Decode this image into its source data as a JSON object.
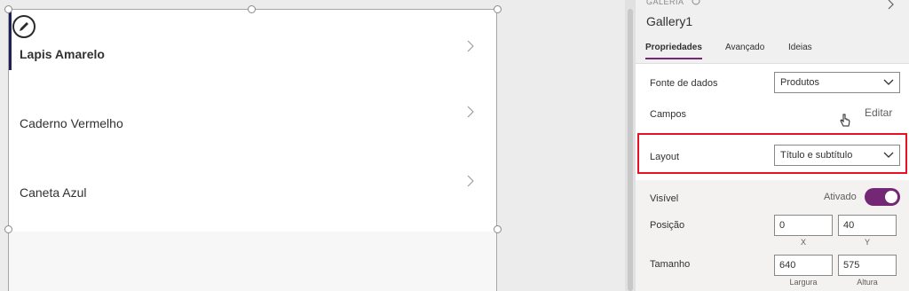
{
  "gallery": {
    "rows": [
      {
        "title": "Lapis Amarelo"
      },
      {
        "title": "Caderno Vermelho"
      },
      {
        "title": "Caneta Azul"
      }
    ]
  },
  "panel": {
    "control_type": "GALERIA",
    "control_name": "Gallery1",
    "tabs": [
      {
        "label": "Propriedades",
        "active": true
      },
      {
        "label": "Avançado",
        "active": false
      },
      {
        "label": "Ideias",
        "active": false
      }
    ],
    "data_source": {
      "label": "Fonte de dados",
      "value": "Produtos"
    },
    "fields": {
      "label": "Campos",
      "edit_label": "Editar"
    },
    "layout": {
      "label": "Layout",
      "value": "Título e subtítulo"
    },
    "visible": {
      "label": "Visível",
      "state_label": "Ativado",
      "on": true
    },
    "position": {
      "label": "Posição",
      "x": "0",
      "y": "40",
      "x_label": "X",
      "y_label": "Y"
    },
    "size": {
      "label": "Tamanho",
      "width": "640",
      "height": "575",
      "width_label": "Largura",
      "height_label": "Altura"
    }
  },
  "colors": {
    "accent": "#742774",
    "highlight": "#e81123",
    "selected_bar": "#1f1f5c"
  },
  "icons": [
    "edit-pencil-icon",
    "chevron-right-icon",
    "chevron-down-icon",
    "info-icon",
    "hand-cursor-icon"
  ]
}
